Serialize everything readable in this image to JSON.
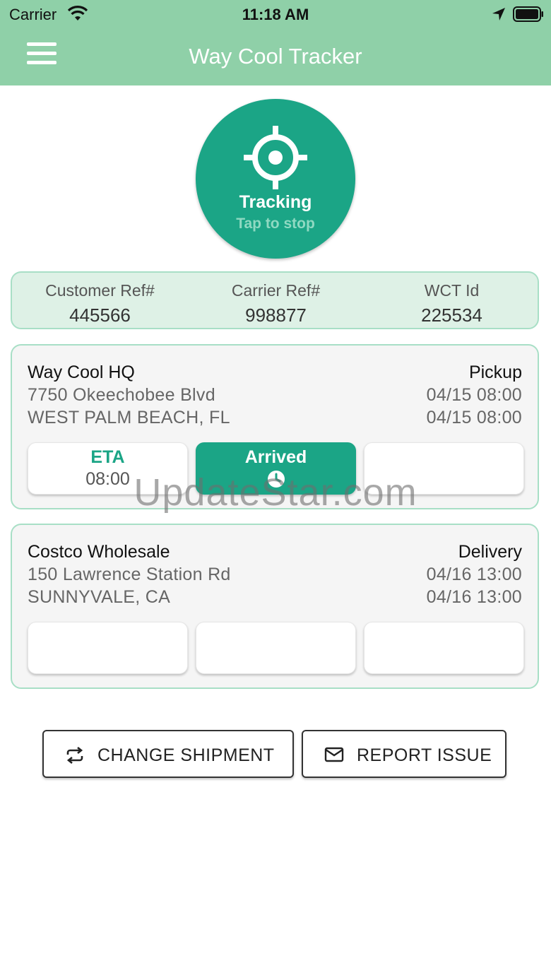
{
  "status_bar": {
    "carrier": "Carrier",
    "time": "11:18 AM"
  },
  "header": {
    "title": "Way Cool Tracker",
    "menu_icon": "hamburger-menu-icon"
  },
  "tracking": {
    "label": "Tracking",
    "subtitle": "Tap to stop",
    "icon": "crosshair-target-icon"
  },
  "refs": [
    {
      "label": "Customer Ref#",
      "value": "445566"
    },
    {
      "label": "Carrier Ref#",
      "value": "998877"
    },
    {
      "label": "WCT Id",
      "value": "225534"
    }
  ],
  "stops": [
    {
      "name": "Way Cool HQ",
      "type": "Pickup",
      "address1": "7750 Okeechobee Blvd",
      "address2": "WEST PALM BEACH, FL",
      "date1": "04/15 08:00",
      "date2": "04/15 08:00",
      "tiles": [
        {
          "label": "ETA",
          "value": "08:00"
        },
        {
          "label": "Arrived",
          "icon": "clock-icon"
        },
        {
          "label": ""
        }
      ]
    },
    {
      "name": "Costco Wholesale",
      "type": "Delivery",
      "address1": "150 Lawrence Station Rd",
      "address2": "SUNNYVALE, CA",
      "date1": "04/16 13:00",
      "date2": "04/16 13:00",
      "tiles": [
        {
          "label": ""
        },
        {
          "label": ""
        },
        {
          "label": ""
        }
      ]
    }
  ],
  "actions": {
    "change_shipment": "CHANGE SHIPMENT",
    "report_issue": "REPORT ISSUE"
  },
  "watermark": "UpdateStar.com",
  "colors": {
    "header": "#8fd0a8",
    "accent": "#1ba586",
    "card_border": "#a8dfc6",
    "ref_bg": "#def1e6"
  }
}
